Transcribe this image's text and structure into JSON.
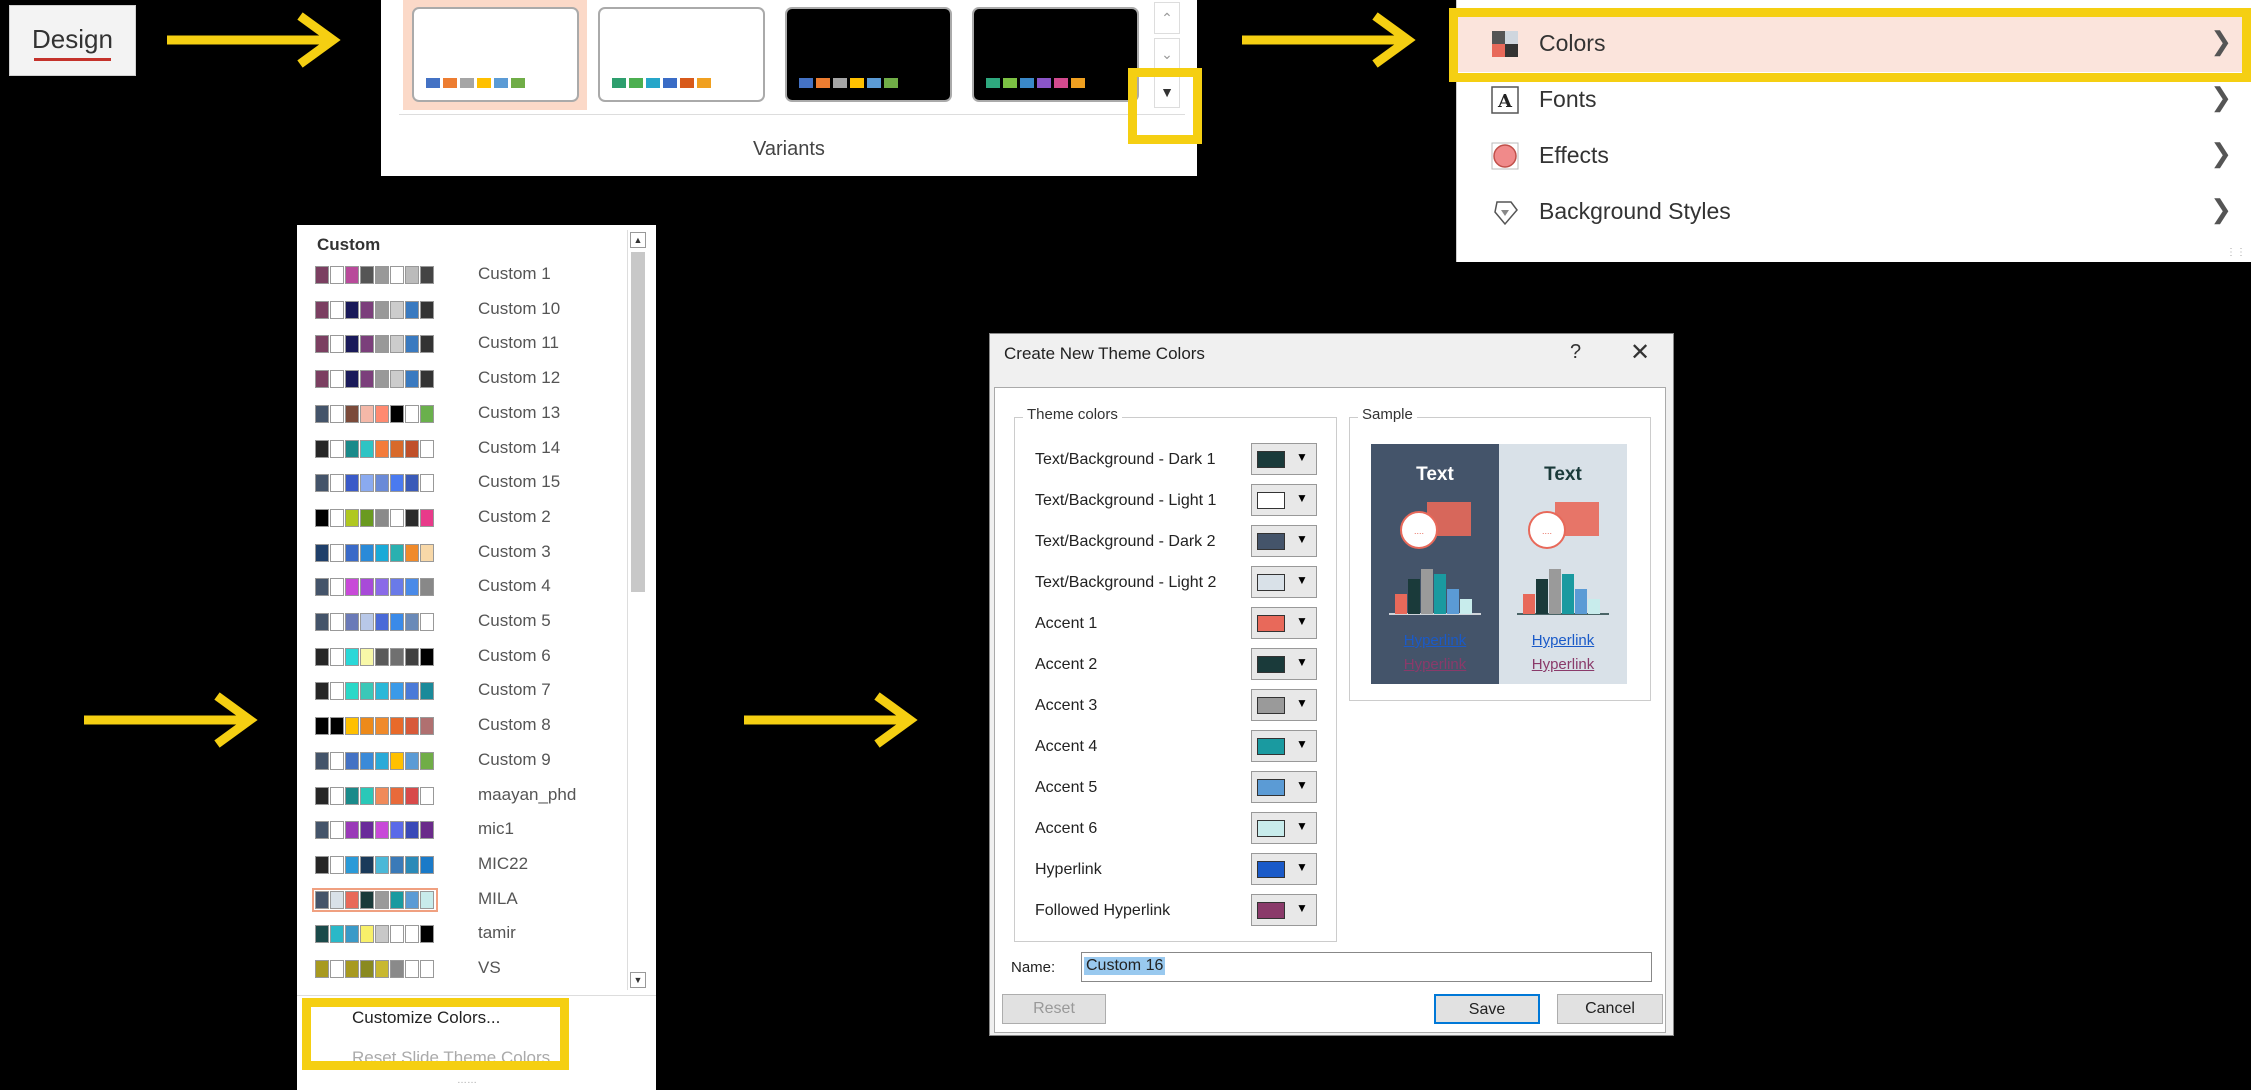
{
  "design_tab": {
    "label": "Design"
  },
  "variants": {
    "label": "Variants",
    "thumbnails": [
      {
        "bg": "#ffffff",
        "colors": [
          "#4472c4",
          "#ed7d31",
          "#a5a5a5",
          "#ffc000",
          "#5b9bd5",
          "#70ad47"
        ]
      },
      {
        "bg": "#ffffff",
        "colors": [
          "#2e9f6e",
          "#4caf50",
          "#26a6c9",
          "#3a6cc6",
          "#d85a1b",
          "#f0a020"
        ]
      },
      {
        "bg": "#000000",
        "colors": [
          "#4472c4",
          "#ed7d31",
          "#a5a5a5",
          "#ffc000",
          "#5b9bd5",
          "#70ad47"
        ]
      },
      {
        "bg": "#000000",
        "colors": [
          "#2ea87e",
          "#7bc043",
          "#3a88c8",
          "#8a55c8",
          "#d24a8e",
          "#f0a020"
        ]
      }
    ]
  },
  "design_menu": {
    "items": [
      {
        "label": "Colors",
        "icon": "colors-icon"
      },
      {
        "label": "Fonts",
        "icon": "fonts-icon"
      },
      {
        "label": "Effects",
        "icon": "effects-icon"
      },
      {
        "label": "Background Styles",
        "icon": "background-styles-icon"
      }
    ]
  },
  "color_list": {
    "header": "Custom",
    "items": [
      {
        "name": "Custom 1",
        "colors": [
          "#7b3f61",
          "#ffffff",
          "#b84a9a",
          "#555555",
          "#999999",
          "#ffffff",
          "#bbbbbb",
          "#444444"
        ]
      },
      {
        "name": "Custom 10",
        "colors": [
          "#7b3f61",
          "#ffffff",
          "#1a1a5a",
          "#7b3f7b",
          "#999999",
          "#cccccc",
          "#3a7ac0",
          "#333333"
        ]
      },
      {
        "name": "Custom 11",
        "colors": [
          "#7b3f61",
          "#ffffff",
          "#1a1a5a",
          "#7b3f7b",
          "#999999",
          "#cccccc",
          "#3a7ac0",
          "#333333"
        ]
      },
      {
        "name": "Custom 12",
        "colors": [
          "#7b3f61",
          "#ffffff",
          "#1a1a5a",
          "#7b3f7b",
          "#999999",
          "#cccccc",
          "#3a7ac0",
          "#333333"
        ]
      },
      {
        "name": "Custom 13",
        "colors": [
          "#44546a",
          "#ffffff",
          "#7b4a3a",
          "#f4b8a8",
          "#ff8a70",
          "#000000",
          "#ffffff",
          "#6ab04c"
        ]
      },
      {
        "name": "Custom 14",
        "colors": [
          "#262626",
          "#ffffff",
          "#1a8a8a",
          "#2ec4c4",
          "#f47b3a",
          "#d86a2a",
          "#c0502a",
          "#ffffff"
        ]
      },
      {
        "name": "Custom 15",
        "colors": [
          "#44546a",
          "#ffffff",
          "#3a5ac8",
          "#8aaaf0",
          "#6a8ad8",
          "#4a7af0",
          "#3a5ab8",
          "#ffffff"
        ]
      },
      {
        "name": "Custom 2",
        "colors": [
          "#000000",
          "#ffffff",
          "#b0c820",
          "#6a9a20",
          "#8a8a8a",
          "#ffffff",
          "#2a2a2a",
          "#e83a8a"
        ]
      },
      {
        "name": "Custom 3",
        "colors": [
          "#1f3f6a",
          "#ffffff",
          "#3a6ac8",
          "#2a8ad8",
          "#1aaad8",
          "#2ab0b0",
          "#f08a2a",
          "#f8d8a8"
        ]
      },
      {
        "name": "Custom 4",
        "colors": [
          "#44546a",
          "#ffffff",
          "#c84ad8",
          "#a84ad8",
          "#8a6ae8",
          "#6a7ae8",
          "#4a8ae8",
          "#888888"
        ]
      },
      {
        "name": "Custom 5",
        "colors": [
          "#44546a",
          "#ffffff",
          "#6a7ab8",
          "#b8c8e8",
          "#4a6ad8",
          "#3a8ae8",
          "#6a8ab8",
          "#ffffff"
        ]
      },
      {
        "name": "Custom 6",
        "colors": [
          "#262626",
          "#ffffff",
          "#2ad8d8",
          "#f8f8a8",
          "#5a5a5a",
          "#707070",
          "#404040",
          "#000000"
        ]
      },
      {
        "name": "Custom 7",
        "colors": [
          "#262626",
          "#ffffff",
          "#2ad8c8",
          "#3ac8b8",
          "#2ab8d8",
          "#3a9ae8",
          "#4a7ad8",
          "#1a8a9a"
        ]
      },
      {
        "name": "Custom 8",
        "colors": [
          "#000000",
          "#000000",
          "#ffc000",
          "#ed8a1a",
          "#f08a2a",
          "#e86a2a",
          "#d85a3a",
          "#b07070"
        ]
      },
      {
        "name": "Custom 9",
        "colors": [
          "#44546a",
          "#ffffff",
          "#4472c4",
          "#3a8ad8",
          "#2aaad8",
          "#ffc000",
          "#5b9bd5",
          "#70ad47"
        ]
      },
      {
        "name": "maayan_phd",
        "colors": [
          "#262626",
          "#ffffff",
          "#1a8a8a",
          "#2ac8b8",
          "#f08a5a",
          "#e86a3a",
          "#d84a4a",
          "#ffffff"
        ]
      },
      {
        "name": "mic1",
        "colors": [
          "#44546a",
          "#ffffff",
          "#9a3ab8",
          "#6a2a9a",
          "#c84ad8",
          "#5a6ae8",
          "#3a4ab8",
          "#6a2a8a"
        ]
      },
      {
        "name": "MIC22",
        "colors": [
          "#262626",
          "#ffffff",
          "#2a9ad8",
          "#1a3a5a",
          "#4ab8d8",
          "#3a7ab8",
          "#2a8ab8",
          "#1a7ac8"
        ]
      },
      {
        "name": "MILA",
        "colors": [
          "#44546a",
          "#d9e1e8",
          "#e8695a",
          "#1a3a3a",
          "#9a9a9a",
          "#1a9aa0",
          "#5b9bd5",
          "#c8ecec"
        ]
      },
      {
        "name": "tamir",
        "colors": [
          "#1a4a4a",
          "#2ab8c8",
          "#3a9ac8",
          "#f8f06a",
          "#c8c8c8",
          "#ffffff",
          "#ffffff",
          "#000000"
        ]
      },
      {
        "name": "VS",
        "colors": [
          "#a89a20",
          "#ffffff",
          "#a89a20",
          "#8a8a20",
          "#c8b830",
          "#8a8a8a",
          "#ffffff",
          "#ffffff"
        ]
      }
    ],
    "customize_label": "Customize Colors...",
    "reset_label": "Reset Slide Theme Colors"
  },
  "dialog": {
    "title": "Create New Theme Colors",
    "help": "?",
    "close": "✕",
    "theme_colors_legend": "Theme colors",
    "sample_legend": "Sample",
    "rows": [
      {
        "label": "Text/Background - Dark 1",
        "color": "#1a3a3a"
      },
      {
        "label": "Text/Background - Light 1",
        "color": "#ffffff"
      },
      {
        "label": "Text/Background - Dark 2",
        "color": "#44546a"
      },
      {
        "label": "Text/Background - Light 2",
        "color": "#d9e1e8"
      },
      {
        "label": "Accent 1",
        "color": "#e8695a"
      },
      {
        "label": "Accent 2",
        "color": "#1a3a3a"
      },
      {
        "label": "Accent 3",
        "color": "#9a9a9a"
      },
      {
        "label": "Accent 4",
        "color": "#1a9aa0"
      },
      {
        "label": "Accent 5",
        "color": "#5b9bd5"
      },
      {
        "label": "Accent 6",
        "color": "#c8ecec"
      },
      {
        "label": "Hyperlink",
        "color": "#1a5ac8"
      },
      {
        "label": "Followed Hyperlink",
        "color": "#8a3a6a"
      }
    ],
    "sample": {
      "text": "Text",
      "hyperlink": "Hyperlink",
      "followed_hyperlink": "Hyperlink",
      "dark_bg": "#44546a",
      "light_bg": "#d9e1e8"
    },
    "name_label": "Name:",
    "name_value": "Custom 16",
    "reset_label": "Reset",
    "save_label": "Save",
    "cancel_label": "Cancel"
  },
  "accent_color": "#f5cf12"
}
